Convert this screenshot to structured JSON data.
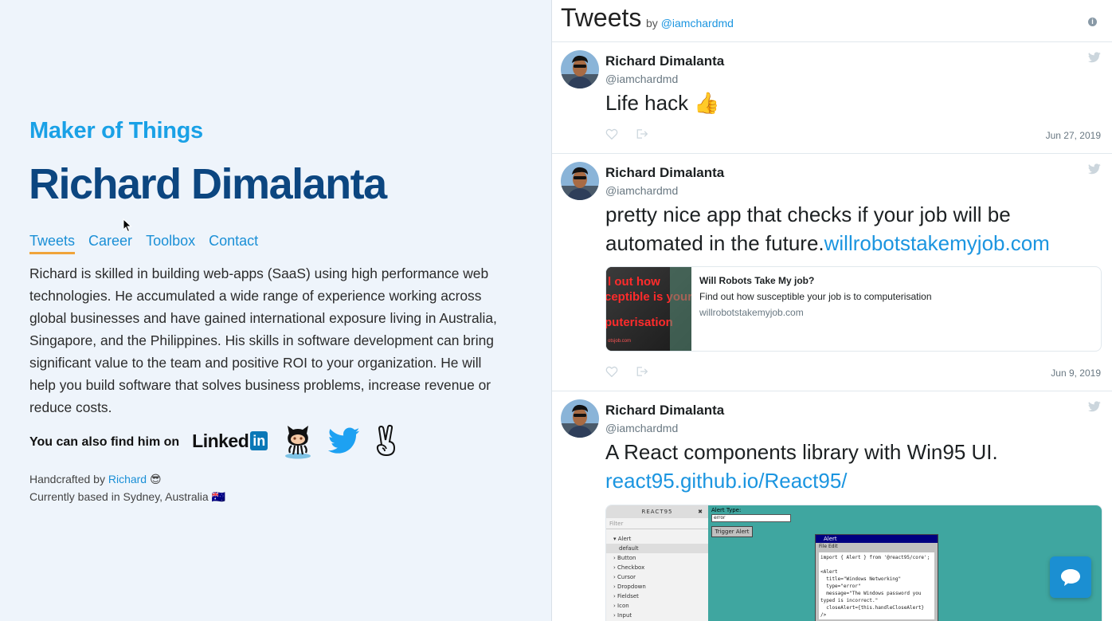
{
  "profile": {
    "tagline": "Maker of Things",
    "name": "Richard Dimalanta",
    "nav": [
      {
        "label": "Tweets",
        "active": true
      },
      {
        "label": "Career",
        "active": false
      },
      {
        "label": "Toolbox",
        "active": false
      },
      {
        "label": "Contact",
        "active": false
      }
    ],
    "bio": "Richard is skilled in building web-apps (SaaS) using high performance web technologies. He accumulated a wide range of experience working across global businesses and have gained international exposure living in Australia, Singapore, and the Philippines. His skills in software development can bring significant value to the team and positive ROI to your organization. He will help you build software that solves business problems, increase revenue or reduce costs.",
    "find_label": "You can also find him on",
    "social_icons": [
      "linkedin-icon",
      "github-octocat-icon",
      "twitter-icon",
      "angellist-icon"
    ],
    "linkedin_text": "Linked",
    "linkedin_in": "in",
    "footer_handcrafted": "Handcrafted by",
    "footer_author": "Richard",
    "footer_author_emoji": "😎",
    "footer_location": "Currently based in Sydney, Australia",
    "footer_flag": "🇦🇺"
  },
  "timeline": {
    "title": "Tweets",
    "by": "by",
    "handle_link": "@iamchardmd",
    "info_icon": "i",
    "tweets": [
      {
        "name": "Richard Dimalanta",
        "handle": "@iamchardmd",
        "text": "Life hack",
        "emoji": "👍",
        "date": "Jun 27, 2019"
      },
      {
        "name": "Richard Dimalanta",
        "handle": "@iamchardmd",
        "text": "pretty nice app that checks if your job will be automated in the future.",
        "link": "willrobotstakemyjob.com",
        "card": {
          "title": "Will Robots Take My job?",
          "description": "Find out how susceptible your job is to computerisation",
          "domain": "willrobotstakemyjob.com",
          "image_lines": [
            "l out how",
            "ceptible is your",
            "puterisation"
          ],
          "image_footer": "otsjob.com"
        },
        "date": "Jun 9, 2019"
      },
      {
        "name": "Richard Dimalanta",
        "handle": "@iamchardmd",
        "text": "A React components library with Win95 UI.",
        "link": "react95.github.io/React95/",
        "media": {
          "sidebar_title": "REACT95",
          "sidebar_close": "✖",
          "filter_placeholder": "Filter",
          "items": [
            "Alert",
            "default",
            "Button",
            "Checkbox",
            "Cursor",
            "Dropdown",
            "Fieldset",
            "Icon",
            "Input"
          ],
          "alert_type_label": "Alert Type:",
          "alert_type_value": "error",
          "trigger_button": "Trigger Alert",
          "window_title": "Alert",
          "window_menu": "File   Edit",
          "code": "import { Alert } from '@react95/core';\n\n<Alert\n  title=\"Windows Networking\"\n  type=\"error\"\n  message=\"The Windows password you\ntyped is incorrect.\"\n  closeAlert={this.handleCloseAlert}\n/>"
        }
      }
    ]
  },
  "colors": {
    "accent": "#1aa1e6",
    "name_color": "#0c4680",
    "nav_underline": "#f0a43a",
    "twitter_blue": "#1b95e0"
  }
}
